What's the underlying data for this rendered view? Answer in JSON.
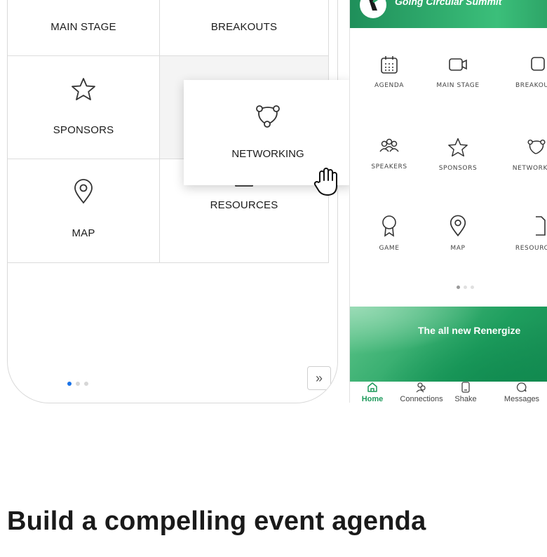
{
  "left_grid": {
    "cells": [
      {
        "label": "MAIN STAGE",
        "icon": "video-camera-icon"
      },
      {
        "label": "BREAKOUTS",
        "icon": "breakout-groups-icon"
      },
      {
        "label": "SPONSORS",
        "icon": "star-icon"
      },
      {
        "label": "MAP",
        "icon": "map-pin-icon"
      },
      {
        "label": "RESOURCES",
        "icon": "document-icon"
      }
    ],
    "dragged_card": {
      "label": "NETWORKING",
      "icon": "network-icon"
    },
    "pagination": {
      "pages": 3,
      "active": 1
    },
    "more_button": "»"
  },
  "app_preview": {
    "title": "Going Circular Summit",
    "grid": [
      {
        "label": "AGENDA",
        "icon": "calendar-icon"
      },
      {
        "label": "MAIN STAGE",
        "icon": "video-camera-icon"
      },
      {
        "label": "BREAKOUTS",
        "icon": "breakout-groups-icon"
      },
      {
        "label": "SPEAKERS",
        "icon": "speakers-icon"
      },
      {
        "label": "SPONSORS",
        "icon": "star-icon"
      },
      {
        "label": "NETWORKING",
        "icon": "network-icon"
      },
      {
        "label": "GAME",
        "icon": "award-icon"
      },
      {
        "label": "MAP",
        "icon": "map-pin-icon"
      },
      {
        "label": "RESOURCES",
        "icon": "document-icon"
      }
    ],
    "pagination": {
      "pages": 3,
      "active": 1
    },
    "banner_text": "The all new Renergize",
    "tabs": [
      {
        "label": "Home",
        "icon": "home-icon",
        "active": true
      },
      {
        "label": "Connections",
        "icon": "connections-icon",
        "active": false
      },
      {
        "label": "Shake",
        "icon": "phone-shake-icon",
        "active": false
      },
      {
        "label": "Messages",
        "icon": "chat-icon",
        "active": false
      }
    ]
  },
  "headline": "Build a compelling event agenda",
  "colors": {
    "accent_green": "#1f9a5c",
    "pagination_active": "#1a73e8"
  }
}
